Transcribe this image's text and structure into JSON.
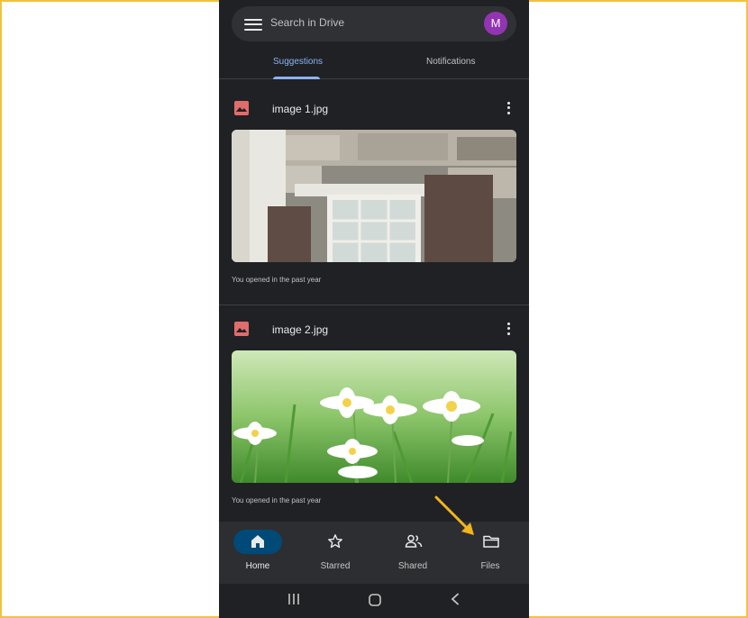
{
  "search": {
    "placeholder": "Search in Drive",
    "avatar_initial": "M"
  },
  "tabs": [
    {
      "label": "Suggestions",
      "active": true
    },
    {
      "label": "Notifications",
      "active": false
    }
  ],
  "files": [
    {
      "name": "image 1.jpg",
      "meta": "You opened in the past year",
      "thumbnail": "stone-house-window"
    },
    {
      "name": "image 2.jpg",
      "meta": "You opened in the past year",
      "thumbnail": "white-daisies-grass"
    }
  ],
  "bottom_nav": [
    {
      "label": "Home",
      "icon": "home-icon",
      "active": true
    },
    {
      "label": "Starred",
      "icon": "star-icon",
      "active": false
    },
    {
      "label": "Shared",
      "icon": "people-icon",
      "active": false
    },
    {
      "label": "Files",
      "icon": "folder-icon",
      "active": false
    }
  ],
  "colors": {
    "accent": "#8ab4f8",
    "avatar": "#9334b3",
    "active_pill": "#004a77",
    "annotation_arrow": "#f2b51b",
    "file_icon": "#e06c6c"
  }
}
